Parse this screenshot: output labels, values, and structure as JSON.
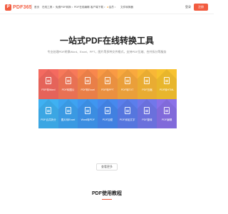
{
  "header": {
    "logo_text": "PDF365",
    "nav": [
      {
        "label": "首页",
        "has_arrow": false
      },
      {
        "label": "在线工具",
        "has_arrow": true
      },
      {
        "label": "免费PDF转换",
        "has_arrow": true
      },
      {
        "label": "PDF在线编辑",
        "has_arrow": false
      },
      {
        "label": "客户端下载",
        "has_arrow": true
      },
      {
        "label": "会员",
        "has_arrow": true
      },
      {
        "label": "文件转换器",
        "has_arrow": false
      }
    ],
    "login": "登录",
    "register": "注册"
  },
  "hero": {
    "title": "一站式PDF在线转换工具",
    "subtitle": "专业处理PDF转换Word、Excel、PPT，图片等多种文件格式，支持PDF压缩、合并拆分等服务"
  },
  "tools": [
    {
      "label": "PDF转Word",
      "color": "#f46a60"
    },
    {
      "label": "PDF转图片",
      "color": "#f7795a"
    },
    {
      "label": "PDF转Excel",
      "color": "#f8874d"
    },
    {
      "label": "PDF转PPT",
      "color": "#f99a44"
    },
    {
      "label": "PDF转TXT",
      "color": "#f9a93e"
    },
    {
      "label": "PDF压缩",
      "color": "#f8b736"
    },
    {
      "label": "PDF转HTML",
      "color": "#f7c22f"
    },
    {
      "label": "PDF合并拆分",
      "color": "#3fb1f2"
    },
    {
      "label": "图片转Excel",
      "color": "#3ea3f1"
    },
    {
      "label": "Word转PDF",
      "color": "#3f96f0"
    },
    {
      "label": "PDF加密",
      "color": "#4689ee"
    },
    {
      "label": "PDF添加文字",
      "color": "#5b7eec"
    },
    {
      "label": "PDF旋转",
      "color": "#7177ea"
    },
    {
      "label": "PDF编辑",
      "color": "#8a71e8"
    }
  ],
  "more_button": "查看更多",
  "tutorial": {
    "title": "PDF使用教程",
    "accent": "#f25c40"
  }
}
